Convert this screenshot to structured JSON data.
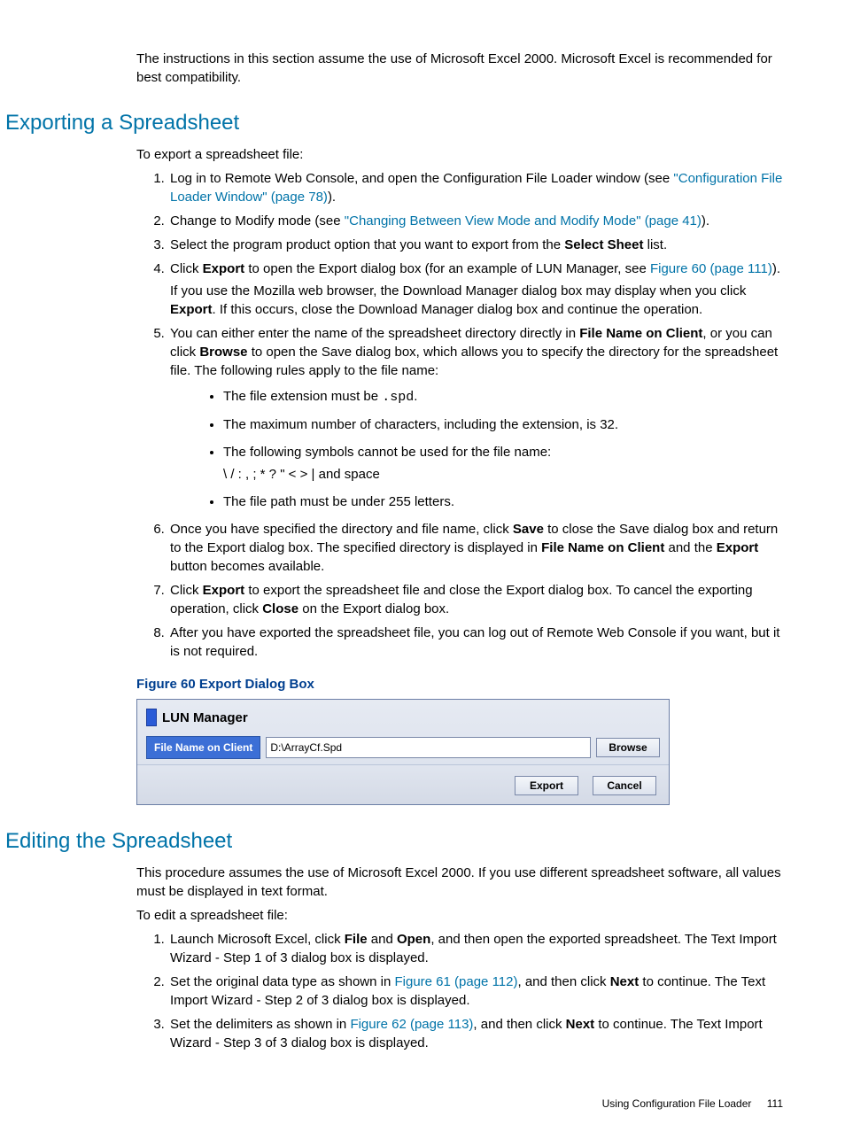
{
  "intro_text": "The instructions in this section assume the use of Microsoft Excel 2000. Microsoft Excel is recommended for best compatibility.",
  "section1": {
    "heading": "Exporting a Spreadsheet",
    "lead": "To export a spreadsheet file:",
    "step1_a": "Log in to Remote Web Console, and open the Configuration File Loader window (see ",
    "step1_link": "\"Configuration File Loader Window\" (page 78)",
    "step1_b": ").",
    "step2_a": "Change to Modify mode (see ",
    "step2_link": "\"Changing Between View Mode and Modify Mode\" (page 41)",
    "step2_b": ").",
    "step3_a": "Select the program product option that you want to export from the ",
    "step3_bold": "Select Sheet",
    "step3_b": " list.",
    "step4_a": "Click ",
    "step4_bold": "Export",
    "step4_b": " to open the Export dialog box (for an example of LUN Manager, see ",
    "step4_link": "Figure 60 (page 111)",
    "step4_c": ").",
    "step4_p2_a": "If you use the Mozilla web browser, the Download Manager dialog box may display when you click ",
    "step4_p2_bold": "Export",
    "step4_p2_b": ". If this occurs, close the Download Manager dialog box and continue the operation.",
    "step5_a": "You can either enter the name of the spreadsheet directory directly in ",
    "step5_bold1": "File Name on Client",
    "step5_b": ", or you can click ",
    "step5_bold2": "Browse",
    "step5_c": " to open the Save dialog box, which allows you to specify the directory for the spreadsheet file. The following rules apply to the file name:",
    "bullet1_a": "The file extension must be ",
    "bullet1_code": ".spd",
    "bullet1_b": ".",
    "bullet2": "The maximum number of characters, including the extension, is 32.",
    "bullet3": "The following symbols cannot be used for the file name:",
    "bullet3_syms": "\\ / : , ; * ? \" < > | and space",
    "bullet4": "The file path must be under 255 letters.",
    "step6_a": "Once you have specified the directory and file name, click ",
    "step6_bold1": "Save",
    "step6_b": " to close the Save dialog box and return to the Export dialog box. The specified directory is displayed in ",
    "step6_bold2": "File Name on Client",
    "step6_c": " and the ",
    "step6_bold3": "Export",
    "step6_d": " button becomes available.",
    "step7_a": "Click ",
    "step7_bold1": "Export",
    "step7_b": " to export the spreadsheet file and close the Export dialog box. To cancel the exporting operation, click ",
    "step7_bold2": "Close",
    "step7_c": " on the Export dialog box.",
    "step8": "After you have exported the spreadsheet file, you can log out of Remote Web Console if you want, but it is not required."
  },
  "figure": {
    "caption": "Figure 60 Export Dialog Box",
    "app_title": "LUN Manager",
    "file_label": "File Name on Client",
    "file_value": "D:\\ArrayCf.Spd",
    "browse": "Browse",
    "export": "Export",
    "cancel": "Cancel"
  },
  "section2": {
    "heading": "Editing the Spreadsheet",
    "lead1": "This procedure assumes the use of Microsoft Excel 2000. If you use different spreadsheet software, all values must be displayed in text format.",
    "lead2": "To edit a spreadsheet file:",
    "step1_a": "Launch Microsoft Excel, click ",
    "step1_bold1": "File",
    "step1_b": " and ",
    "step1_bold2": "Open",
    "step1_c": ", and then open the exported spreadsheet. The Text Import Wizard - Step 1 of 3 dialog box is displayed.",
    "step2_a": "Set the original data type as shown in ",
    "step2_link": "Figure 61 (page 112)",
    "step2_b": ", and then click ",
    "step2_bold": "Next",
    "step2_c": " to continue. The Text Import Wizard - Step 2 of 3 dialog box is displayed.",
    "step3_a": "Set the delimiters as shown in ",
    "step3_link": "Figure 62 (page 113)",
    "step3_b": ", and then click ",
    "step3_bold": "Next",
    "step3_c": " to continue. The Text Import Wizard - Step 3 of 3 dialog box is displayed."
  },
  "footer": {
    "text": "Using Configuration File Loader",
    "page": "111"
  }
}
